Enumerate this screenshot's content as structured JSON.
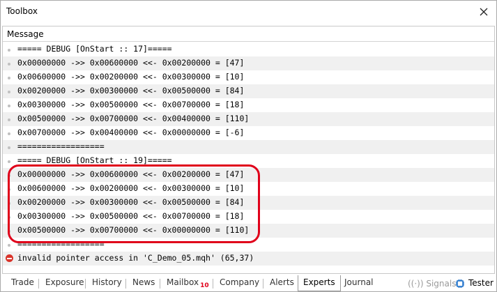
{
  "window": {
    "title": "Toolbox",
    "close_label": "×"
  },
  "panel": {
    "column_header": "Message"
  },
  "log": [
    {
      "type": "debug",
      "text": "===== DEBUG [OnStart :: 17]====="
    },
    {
      "type": "debug",
      "text": "0x00000000 ->> 0x00600000 <<- 0x00200000 = [47]"
    },
    {
      "type": "debug",
      "text": "0x00600000 ->> 0x00200000 <<- 0x00300000 = [10]"
    },
    {
      "type": "debug",
      "text": "0x00200000 ->> 0x00300000 <<- 0x00500000 = [84]"
    },
    {
      "type": "debug",
      "text": "0x00300000 ->> 0x00500000 <<- 0x00700000 = [18]"
    },
    {
      "type": "debug",
      "text": "0x00500000 ->> 0x00700000 <<- 0x00400000 = [110]"
    },
    {
      "type": "debug",
      "text": "0x00700000 ->> 0x00400000 <<- 0x00000000 = [-6]"
    },
    {
      "type": "debug",
      "text": "=================="
    },
    {
      "type": "debug",
      "text": "===== DEBUG [OnStart :: 19]====="
    },
    {
      "type": "debug",
      "text": "0x00000000 ->> 0x00600000 <<- 0x00200000 = [47]"
    },
    {
      "type": "debug",
      "text": "0x00600000 ->> 0x00200000 <<- 0x00300000 = [10]"
    },
    {
      "type": "debug",
      "text": "0x00200000 ->> 0x00300000 <<- 0x00500000 = [84]"
    },
    {
      "type": "debug",
      "text": "0x00300000 ->> 0x00500000 <<- 0x00700000 = [18]"
    },
    {
      "type": "debug",
      "text": "0x00500000 ->> 0x00700000 <<- 0x00000000 = [110]"
    },
    {
      "type": "debug",
      "text": "=================="
    },
    {
      "type": "error",
      "text": "invalid pointer access in 'C_Demo_05.mqh' (65,37)"
    }
  ],
  "tabs": [
    {
      "label": "Trade"
    },
    {
      "label": "Exposure"
    },
    {
      "label": "History"
    },
    {
      "label": "News"
    },
    {
      "label": "Mailbox",
      "badge": "10"
    },
    {
      "label": "Company"
    },
    {
      "label": "Alerts"
    },
    {
      "label": "Experts",
      "active": true
    },
    {
      "label": "Journal"
    }
  ],
  "status": {
    "signals_label": "((·)) Signals",
    "tester_label": "Tester"
  },
  "colors": {
    "highlight": "#e0001a",
    "error": "#d9342b",
    "alt_row": "#f0f0f0"
  }
}
